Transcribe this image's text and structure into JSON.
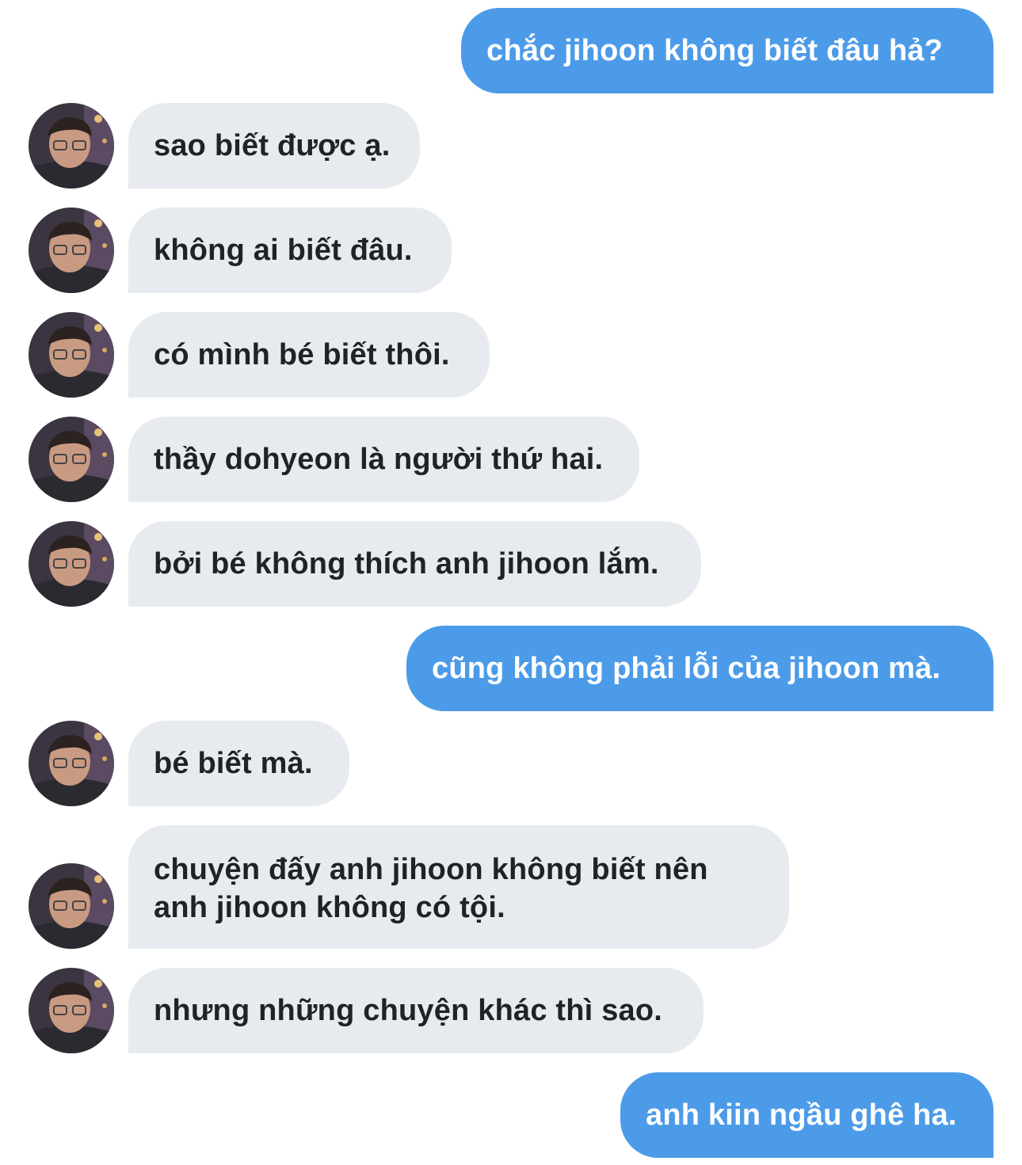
{
  "conversation": {
    "colors": {
      "outgoing_bubble": "#4c9be8",
      "incoming_bubble": "#e7ebf0",
      "incoming_text": "#1f2326",
      "outgoing_text": "#ffffff"
    },
    "messages": [
      {
        "direction": "outgoing",
        "text": "chắc jihoon không biết đâu hả?"
      },
      {
        "direction": "incoming",
        "text": "sao biết được ạ."
      },
      {
        "direction": "incoming",
        "text": "không ai biết đâu."
      },
      {
        "direction": "incoming",
        "text": "có mình bé biết thôi."
      },
      {
        "direction": "incoming",
        "text": "thầy dohyeon là người thứ hai."
      },
      {
        "direction": "incoming",
        "text": "bởi bé không thích anh jihoon lắm."
      },
      {
        "direction": "outgoing",
        "text": "cũng không phải lỗi của jihoon mà."
      },
      {
        "direction": "incoming",
        "text": "bé biết mà."
      },
      {
        "direction": "incoming",
        "text": "chuyện đấy anh jihoon không biết nên anh jihoon không có tội."
      },
      {
        "direction": "incoming",
        "text": "nhưng những chuyện khác thì sao."
      },
      {
        "direction": "outgoing",
        "text": "anh kiin ngầu ghê ha."
      }
    ]
  }
}
